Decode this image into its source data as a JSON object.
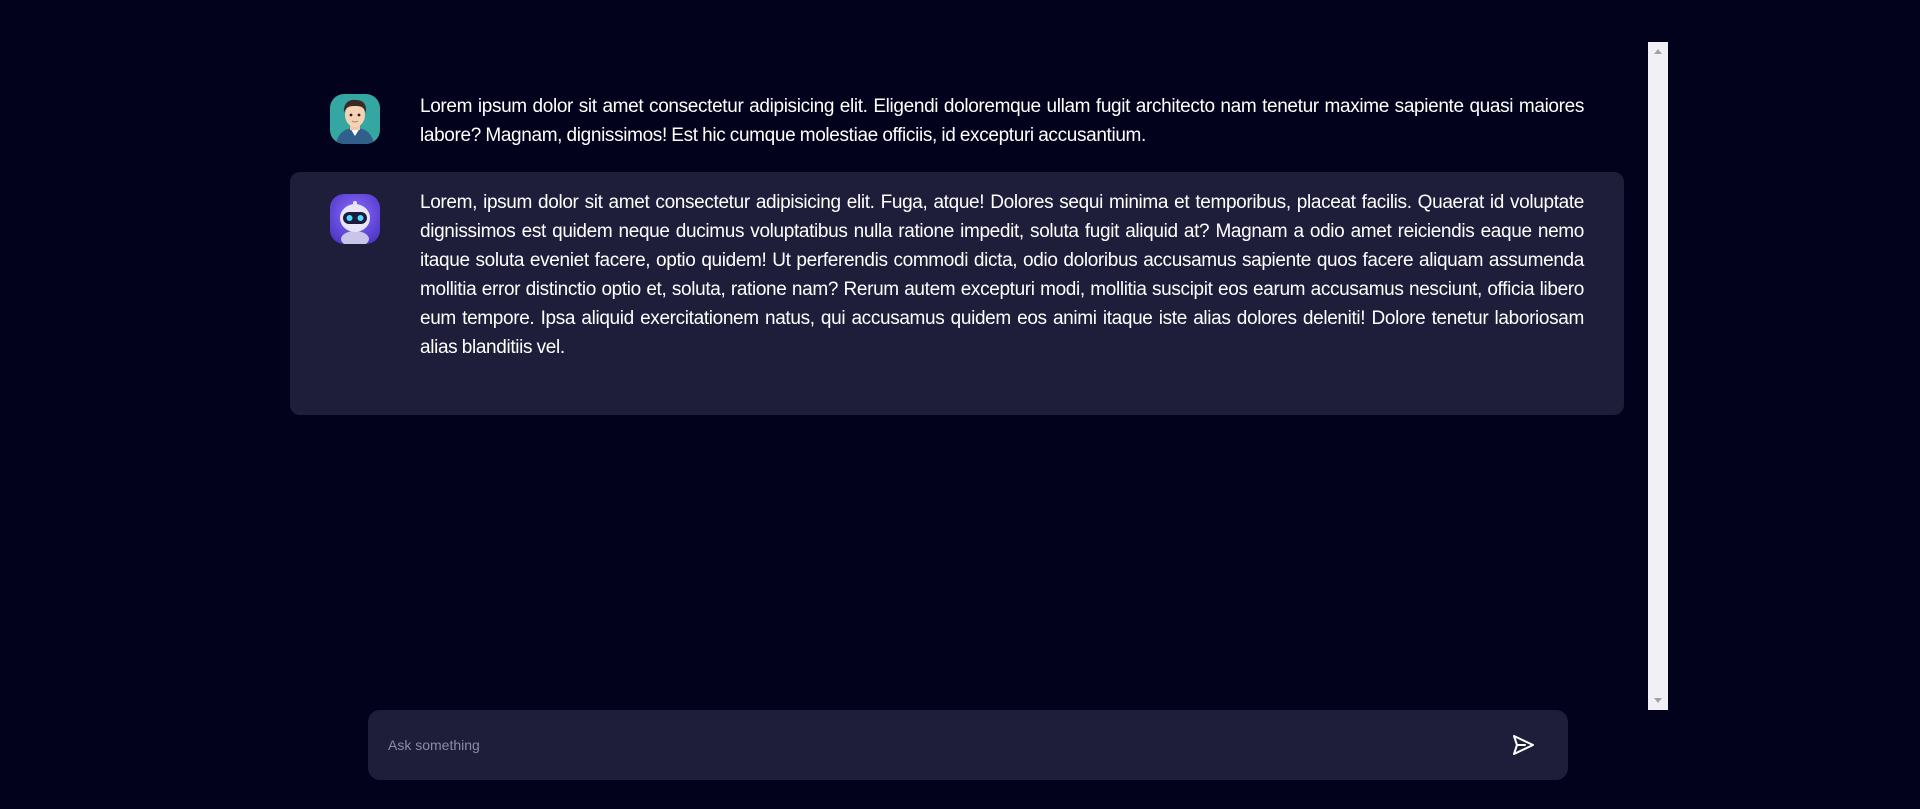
{
  "colors": {
    "background": "#03021c",
    "bot_message_bg": "#1e1e3b",
    "input_bg": "#1e1e3b",
    "text": "#ffffff",
    "placeholder": "#8b8ba3",
    "scrollbar": "#f1f1f5"
  },
  "messages": [
    {
      "role": "user",
      "avatar_icon": "user-avatar-icon",
      "text": "Lorem ipsum dolor sit amet consectetur adipisicing elit. Eligendi doloremque ullam fugit architecto nam tenetur maxime sapiente quasi maiores labore? Magnam, dignissimos! Est hic cumque molestiae officiis, id excepturi accusantium."
    },
    {
      "role": "bot",
      "avatar_icon": "bot-avatar-icon",
      "text": "Lorem, ipsum dolor sit amet consectetur adipisicing elit. Fuga, atque! Dolores sequi minima et temporibus, placeat facilis. Quaerat id voluptate dignissimos est quidem neque ducimus voluptatibus nulla ratione impedit, soluta fugit aliquid at? Magnam a odio amet reiciendis eaque nemo itaque soluta eveniet facere, optio quidem! Ut perferendis commodi dicta, odio doloribus accusamus sapiente quos facere aliquam assumenda mollitia error distinctio optio et, soluta, ratione nam? Rerum autem excepturi modi, mollitia suscipit eos earum accusamus nesciunt, officia libero eum tempore. Ipsa aliquid exercitationem natus, qui accusamus quidem eos animi itaque iste alias dolores deleniti! Dolore tenetur laboriosam alias blanditiis vel."
    }
  ],
  "input": {
    "placeholder": "Ask something",
    "value": "",
    "send_icon": "send-icon"
  }
}
